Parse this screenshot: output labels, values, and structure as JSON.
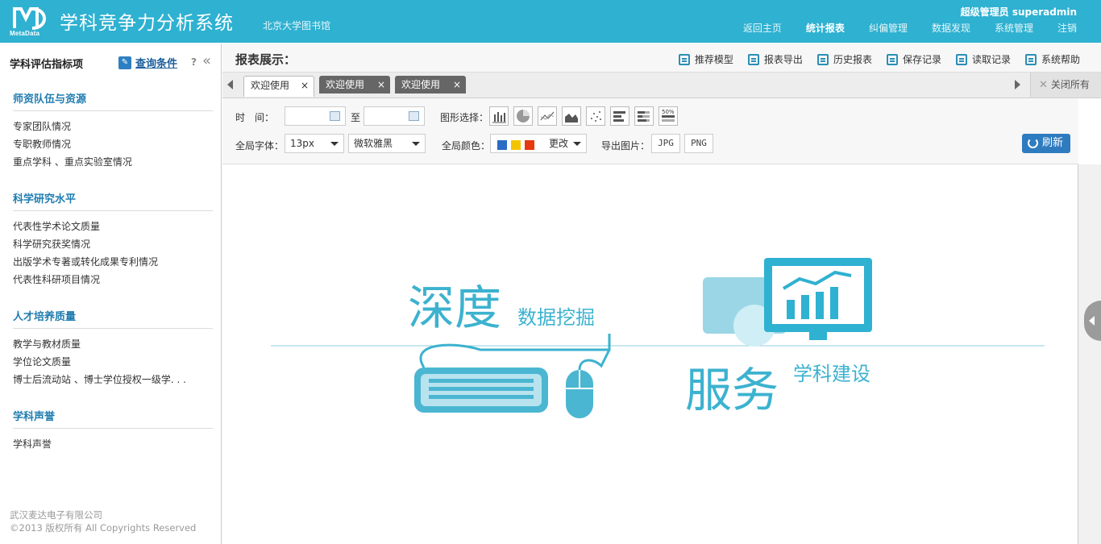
{
  "app": {
    "title": "学科竞争力分析系统",
    "org": "北京大学图书馆",
    "logo_text": "MetaData",
    "user": "超级管理员 superadmin",
    "nav": [
      {
        "label": "返回主页"
      },
      {
        "label": "统计报表",
        "active": true
      },
      {
        "label": "纠偏管理"
      },
      {
        "label": "数据发现"
      },
      {
        "label": "系统管理"
      },
      {
        "label": "注销"
      }
    ],
    "accent": "#2fb1d1"
  },
  "sidebar": {
    "title": "学科评估指标项",
    "query_label": "查询条件",
    "help": "?",
    "collapse": "«",
    "groups": [
      {
        "title": "师资队伍与资源",
        "items": [
          "专家团队情况",
          "专职教师情况",
          "重点学科 、重点实验室情况"
        ]
      },
      {
        "title": "科学研究水平",
        "items": [
          "代表性学术论文质量",
          "科学研究获奖情况",
          "出版学术专著或转化成果专利情况",
          "代表性科研项目情况"
        ]
      },
      {
        "title": "人才培养质量",
        "items": [
          "教学与教材质量",
          "学位论文质量",
          "博士后流动站 、博士学位授权一级学. . ."
        ]
      },
      {
        "title": "学科声誉",
        "items": [
          "学科声誉"
        ]
      }
    ],
    "copyright_1": "武汉麦达电子有限公司",
    "copyright_2": "©2013 版权所有 All Copyrights Reserved"
  },
  "report": {
    "title": "报表展示：",
    "toolbar": [
      "推荐模型",
      "报表导出",
      "历史报表",
      "保存记录",
      "读取记录",
      "系统帮助"
    ],
    "tabs": [
      {
        "label": "欢迎使用",
        "active": true
      },
      {
        "label": "欢迎使用"
      },
      {
        "label": "欢迎使用"
      }
    ],
    "tab_close": "×",
    "close_all": "关闭所有"
  },
  "filters": {
    "time_label": "时　间：",
    "to_label": "至",
    "chart_label": "图形选择：",
    "chart_icons": [
      "bar-chart-icon",
      "pie-chart-icon",
      "line-chart-icon",
      "area-chart-icon",
      "scatter-chart-icon",
      "horizontal-bar-icon",
      "stacked-bar-icon",
      "percent-bar-icon"
    ],
    "percent_label": "50%",
    "font_label": "全局字体：",
    "font_size": "13px",
    "font_family": "微软雅黑",
    "color_label": "全局颜色：",
    "colors": [
      "#2b6cc4",
      "#f5c400",
      "#e8380d"
    ],
    "change_label": "更改",
    "export_label": "导出图片：",
    "export_jpg": "JPG",
    "export_png": "PNG",
    "refresh_label": "刷新"
  },
  "welcome": {
    "depth": "深度",
    "data_mining": "数据挖掘",
    "service": "服务",
    "discipline": "学科建设"
  }
}
